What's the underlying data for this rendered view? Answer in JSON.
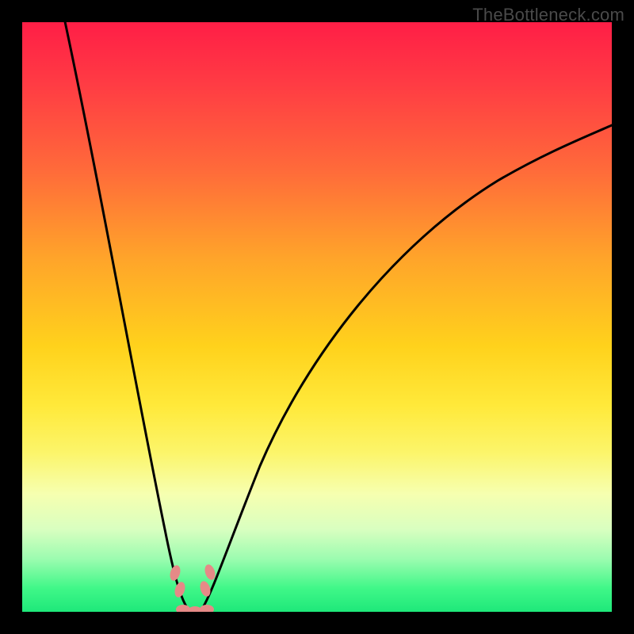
{
  "watermark": {
    "text": "TheBottleneck.com"
  },
  "chart_data": {
    "type": "line",
    "title": "",
    "xlabel": "",
    "ylabel": "",
    "xlim": [
      0,
      100
    ],
    "ylim": [
      0,
      100
    ],
    "grid": false,
    "legend": false,
    "background_gradient": {
      "top_color": "#ff1e46",
      "mid_color": "#ffe93a",
      "bottom_color": "#1ee87a"
    },
    "series": [
      {
        "name": "left-branch",
        "x": [
          7,
          10,
          13,
          16,
          18,
          20,
          22,
          24,
          25,
          26,
          27,
          28
        ],
        "values": [
          100,
          85,
          70,
          55,
          43,
          32,
          22,
          13,
          8,
          4,
          2,
          0
        ]
      },
      {
        "name": "right-branch",
        "x": [
          30,
          32,
          35,
          40,
          45,
          50,
          55,
          60,
          65,
          70,
          75,
          80,
          85,
          90,
          95,
          100
        ],
        "values": [
          0,
          4,
          10,
          20,
          29,
          37,
          44,
          50,
          56,
          61,
          66,
          70,
          74,
          77,
          80,
          83
        ]
      },
      {
        "name": "valley-floor",
        "x": [
          27,
          28,
          29,
          30,
          31
        ],
        "values": [
          0,
          0,
          0,
          0,
          0
        ]
      }
    ],
    "markers": [
      {
        "name": "marker-left-upper",
        "x": 26.0,
        "y": 6.5
      },
      {
        "name": "marker-left-lower",
        "x": 26.8,
        "y": 3.5
      },
      {
        "name": "marker-right-upper",
        "x": 31.8,
        "y": 6.5
      },
      {
        "name": "marker-right-lower",
        "x": 31.0,
        "y": 3.5
      },
      {
        "name": "marker-floor-a",
        "x": 27.5,
        "y": 0.0
      },
      {
        "name": "marker-floor-b",
        "x": 29.0,
        "y": 0.0
      },
      {
        "name": "marker-floor-c",
        "x": 30.5,
        "y": 0.0
      }
    ],
    "colors": {
      "curve_stroke": "#000000",
      "marker_fill": "#e58a87"
    }
  }
}
